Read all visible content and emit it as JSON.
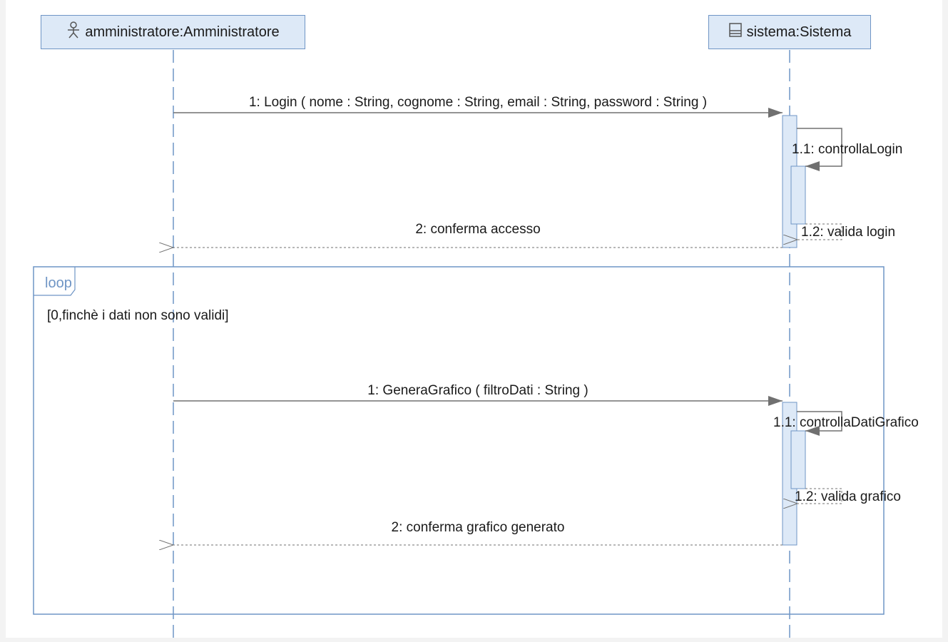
{
  "lifelines": [
    {
      "label": "amministratore:Amministratore",
      "icon": "actor-icon"
    },
    {
      "label": "sistema:Sistema",
      "icon": "class-icon"
    }
  ],
  "messages": [
    {
      "label": "1: Login ( nome : String, cognome : String, email : String, password : String )",
      "kind": "sync"
    },
    {
      "label": "1.1: controllaLogin",
      "kind": "self"
    },
    {
      "label": "1.2: valida login",
      "kind": "self-return"
    },
    {
      "label": "2: conferma accesso",
      "kind": "return"
    }
  ],
  "fragment": {
    "operator": "loop",
    "guard": "[0,finchè i dati non sono validi]",
    "messages": [
      {
        "label": "1: GeneraGrafico ( filtroDati : String )",
        "kind": "sync"
      },
      {
        "label": "1.1: controllaDatiGrafico",
        "kind": "self"
      },
      {
        "label": "1.2: valida grafico",
        "kind": "self-return"
      },
      {
        "label": "2: conferma grafico generato",
        "kind": "return"
      }
    ]
  },
  "colors": {
    "frame": "#6f95c5",
    "head_fill": "#dde9f7",
    "activation_fill": "#dde9f7",
    "lifeline": "#6f95c5",
    "message": "#707070"
  }
}
